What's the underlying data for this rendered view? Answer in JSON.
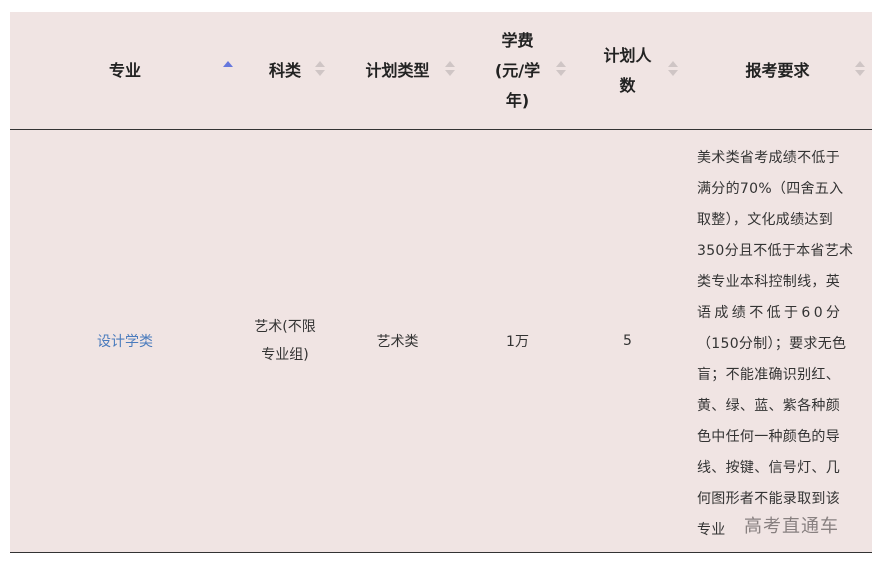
{
  "table": {
    "headers": {
      "major": "专业",
      "category": "科类",
      "plan_type": "计划类型",
      "tuition_1": "学费",
      "tuition_2": "(元/学",
      "tuition_3": "年)",
      "plan_count_1": "计划人",
      "plan_count_2": "数",
      "requirements": "报考要求"
    },
    "sort_state": {
      "major": "ascending"
    },
    "rows": [
      {
        "major": "设计学类",
        "category_1": "艺术(不限",
        "category_2": "专业组)",
        "plan_type": "艺术类",
        "tuition": "1万",
        "plan_count": "5",
        "requirement_lines": [
          "美术类省考成绩不低于",
          "满分的70%（四舍五入",
          "取整），文化成绩达到",
          "350分且不低于本省艺术",
          "类专业本科控制线，英",
          "语成绩不低于60分",
          "（150分制）；要求无色",
          "盲；不能准确识别红、",
          "黄、绿、蓝、紫各种颜",
          "色中任何一种颜色的导",
          "线、按键、信号灯、几",
          "何图形者不能录取到该",
          "专业"
        ]
      }
    ]
  },
  "watermark": "高考直通车",
  "colors": {
    "table_bg": "#f0e4e3",
    "link": "#4a7bbd",
    "sort_active": "#6677dd",
    "sort_inactive": "#cfc5c5"
  }
}
